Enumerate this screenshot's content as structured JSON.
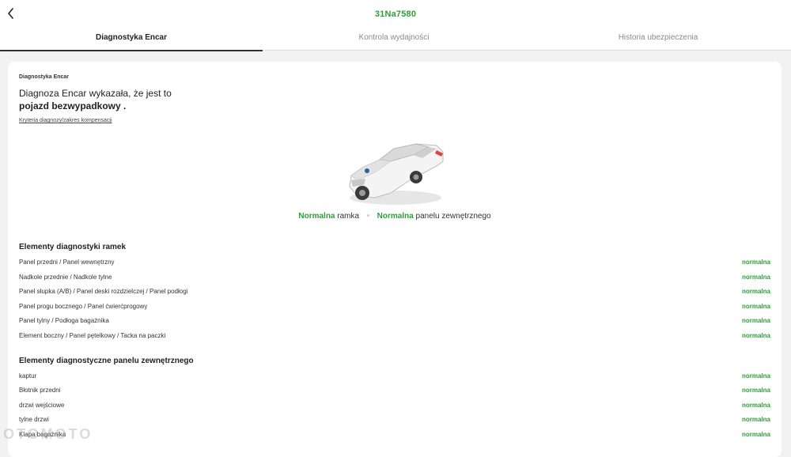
{
  "header": {
    "plate": "31Na7580",
    "tabs": [
      {
        "label": "Diagnostyka Encar"
      },
      {
        "label": "Kontrola wydajności"
      },
      {
        "label": "Historia ubezpieczenia"
      }
    ]
  },
  "summary": {
    "section_label": "Diagnostyka Encar",
    "title_line1": "Diagnoza Encar wykazała, że jest to",
    "title_line2": "pojazd bezwypadkowy .",
    "criteria_link": "Kryteria diagnozy/zakres kompensacji"
  },
  "status": {
    "frame_value": "Normalna",
    "frame_label": "ramka",
    "panel_value": "Normalna",
    "panel_label": "panelu zewnętrznego"
  },
  "frame_section": {
    "title": "Elementy diagnostyki ramek",
    "rows": [
      {
        "name": "Panel przedni / Panel wewnętrzny",
        "value": "normalna"
      },
      {
        "name": "Nadkole przednie / Nadkole tylne",
        "value": "normalna"
      },
      {
        "name": "Panel słupka (A/B) / Panel deski rozdzielczej / Panel podłogi",
        "value": "normalna"
      },
      {
        "name": "Panel progu bocznego / Panel ćwierćprogowy",
        "value": "normalna"
      },
      {
        "name": "Panel tylny / Podłoga bagażnika",
        "value": "normalna"
      },
      {
        "name": "Element boczny / Panel pętelkowy / Tacka na paczki",
        "value": "normalna"
      }
    ]
  },
  "panel_section": {
    "title": "Elementy diagnostyczne panelu zewnętrznego",
    "rows": [
      {
        "name": "kaptur",
        "value": "normalna"
      },
      {
        "name": "Błotnik przedni",
        "value": "normalna"
      },
      {
        "name": "drzwi wejściowe",
        "value": "normalna"
      },
      {
        "name": "tylne drzwi",
        "value": "normalna"
      },
      {
        "name": "Klapa bagażnika",
        "value": "normalna"
      }
    ]
  },
  "watermark_text": "OTOMOTO"
}
